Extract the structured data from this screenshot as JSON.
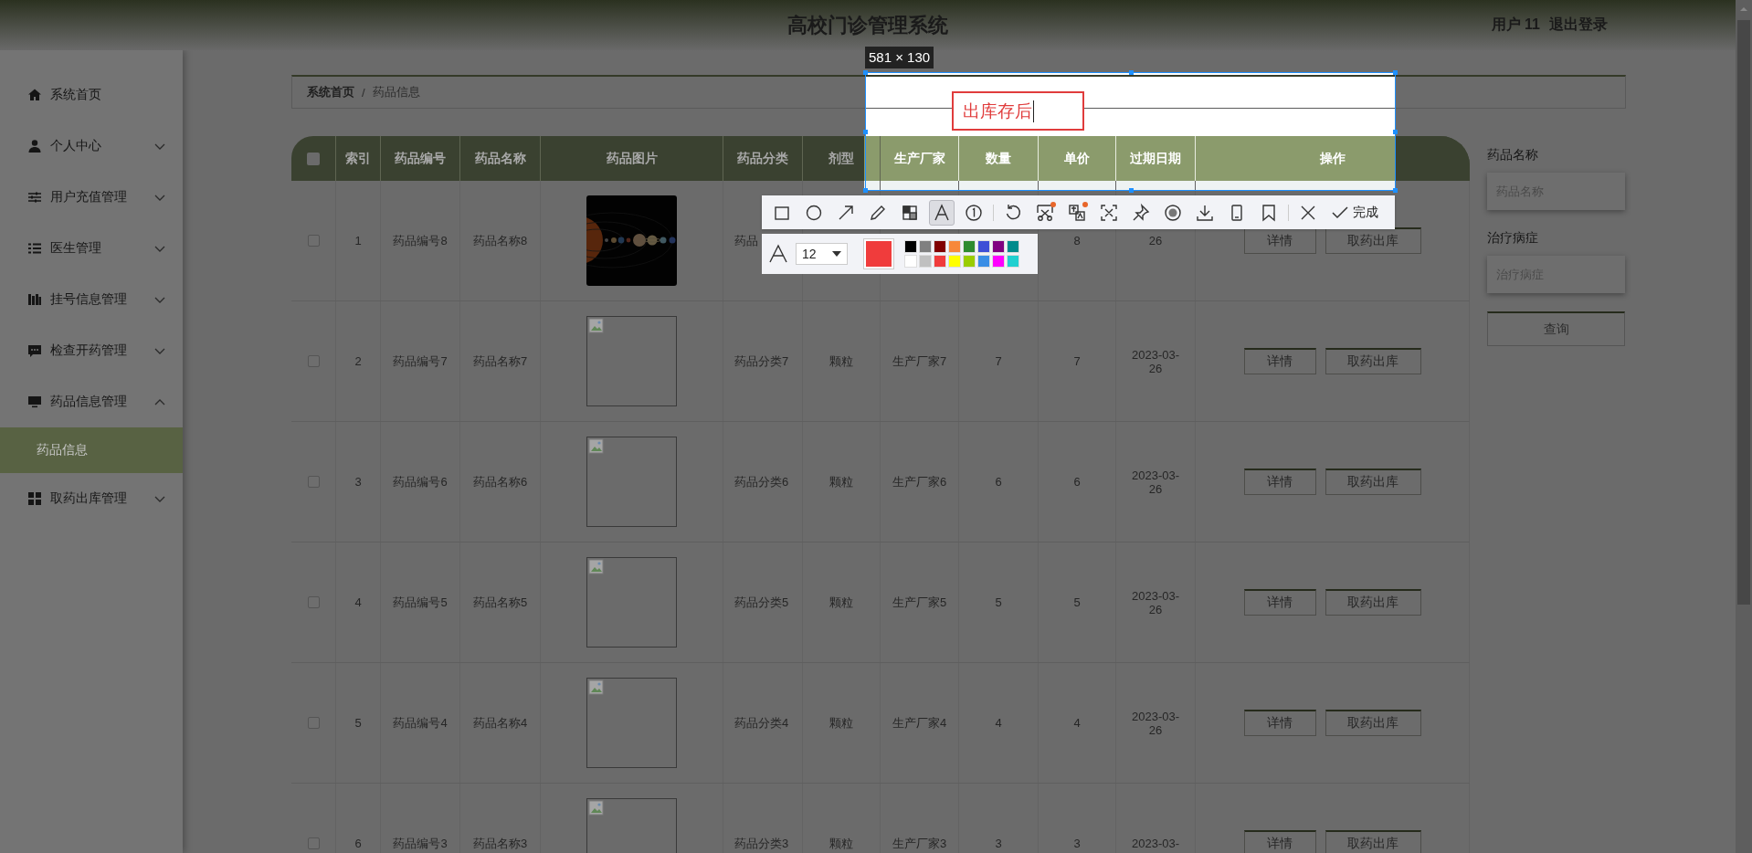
{
  "header": {
    "title": "高校门诊管理系统",
    "user": "用户 11",
    "logout": "退出登录"
  },
  "sidebar": {
    "items": [
      {
        "kind": "link",
        "label": "系统首页"
      },
      {
        "kind": "menu",
        "label": "个人中心",
        "expanded": false
      },
      {
        "kind": "menu",
        "label": "用户充值管理",
        "expanded": false
      },
      {
        "kind": "menu",
        "label": "医生管理",
        "expanded": false
      },
      {
        "kind": "menu",
        "label": "挂号信息管理",
        "expanded": false
      },
      {
        "kind": "menu",
        "label": "检查开药管理",
        "expanded": false
      },
      {
        "kind": "menu",
        "label": "药品信息管理",
        "expanded": true,
        "children": [
          {
            "label": "药品信息",
            "selected": true
          }
        ]
      },
      {
        "kind": "menu",
        "label": "取药出库管理",
        "expanded": false
      }
    ]
  },
  "breadcrumb": {
    "items": [
      "系统首页",
      "药品信息"
    ],
    "separator": "/"
  },
  "table": {
    "header_checked": false,
    "columns": [
      "索引",
      "药品编号",
      "药品名称",
      "药品图片",
      "药品分类",
      "剂型",
      "生产厂家",
      "数量",
      "单价",
      "过期日期",
      "操作"
    ],
    "rows": [
      {
        "checked": false,
        "index": "1",
        "code": "药品编号8",
        "name": "药品名称8",
        "category": "药品",
        "price": "8",
        "date": "26",
        "actions": [
          "详情",
          "取药出库"
        ]
      },
      {
        "checked": false,
        "index": "2",
        "code": "药品编号7",
        "name": "药品名称7",
        "image": {
          "kind": "broken"
        },
        "category": "药品分类7",
        "dosage": "颗粒",
        "maker": "生产厂家7",
        "quantity": "7",
        "price": "7",
        "date": "2023-03-26",
        "actions": [
          "详情",
          "取药出库"
        ]
      },
      {
        "checked": false,
        "index": "3",
        "code": "药品编号6",
        "name": "药品名称6",
        "image": {
          "kind": "broken"
        },
        "category": "药品分类6",
        "dosage": "颗粒",
        "maker": "生产厂家6",
        "quantity": "6",
        "price": "6",
        "date": "2023-03-26",
        "actions": [
          "详情",
          "取药出库"
        ]
      },
      {
        "checked": false,
        "index": "4",
        "code": "药品编号5",
        "name": "药品名称5",
        "image": {
          "kind": "broken"
        },
        "category": "药品分类5",
        "dosage": "颗粒",
        "maker": "生产厂家5",
        "quantity": "5",
        "price": "5",
        "date": "2023-03-26",
        "actions": [
          "详情",
          "取药出库"
        ]
      },
      {
        "checked": false,
        "index": "5",
        "code": "药品编号4",
        "name": "药品名称4",
        "image": {
          "kind": "broken"
        },
        "category": "药品分类4",
        "dosage": "颗粒",
        "maker": "生产厂家4",
        "quantity": "4",
        "price": "4",
        "date": "2023-03-26",
        "actions": [
          "详情",
          "取药出库"
        ]
      },
      {
        "checked": false,
        "index": "6",
        "code": "药品编号3",
        "name": "药品名称3",
        "image": {
          "kind": "broken"
        },
        "category": "药品分类3",
        "dosage": "颗粒",
        "maker": "生产厂家3",
        "quantity": "3",
        "price": "3",
        "date": "2023-03-",
        "actions": [
          "详情",
          "取药出库"
        ]
      }
    ]
  },
  "search": {
    "fields": [
      {
        "label": "药品名称",
        "placeholder": "药品名称"
      },
      {
        "label": "治疗病症",
        "placeholder": "治疗病症"
      }
    ],
    "button": "查询"
  },
  "snip": {
    "size": "581 × 130",
    "annotation": {
      "text": "出库存后",
      "color": "#e03c3c"
    },
    "tools": [
      {
        "selected": false,
        "badge": false
      },
      {
        "selected": false,
        "badge": false
      },
      {
        "selected": false,
        "badge": false
      },
      {
        "selected": false,
        "badge": false
      },
      {
        "selected": false,
        "badge": false
      },
      {
        "selected": true,
        "badge": false
      },
      {
        "selected": false,
        "badge": false
      },
      {
        "selected": false,
        "badge": false
      },
      {
        "selected": false,
        "badge": true
      },
      {
        "selected": false,
        "badge": true
      },
      {
        "selected": false,
        "badge": false
      },
      {
        "selected": false,
        "badge": false
      },
      {
        "selected": false,
        "badge": false
      },
      {
        "selected": false,
        "badge": false
      },
      {
        "selected": false,
        "badge": false
      },
      {
        "selected": false,
        "badge": false
      }
    ],
    "done": "完成",
    "font_size": "12",
    "swatches": [
      {
        "color": "#000000",
        "selected": false
      },
      {
        "color": "#808080",
        "selected": false
      },
      {
        "color": "#800000",
        "selected": false
      },
      {
        "color": "#f7883a",
        "selected": false
      },
      {
        "color": "#2e8b2e",
        "selected": false
      },
      {
        "color": "#3e4fd6",
        "selected": false
      },
      {
        "color": "#800080",
        "selected": false
      },
      {
        "color": "#008b8b",
        "selected": false
      },
      {
        "color": "#ffffff",
        "selected": false
      },
      {
        "color": "#c0c0c0",
        "selected": false
      },
      {
        "color": "#f03c3c",
        "selected": true
      },
      {
        "color": "#ffff00",
        "selected": false
      },
      {
        "color": "#9acd00",
        "selected": false
      },
      {
        "color": "#3a8ee6",
        "selected": false
      },
      {
        "color": "#ff00ff",
        "selected": false
      },
      {
        "color": "#20d0d0",
        "selected": false
      }
    ]
  }
}
